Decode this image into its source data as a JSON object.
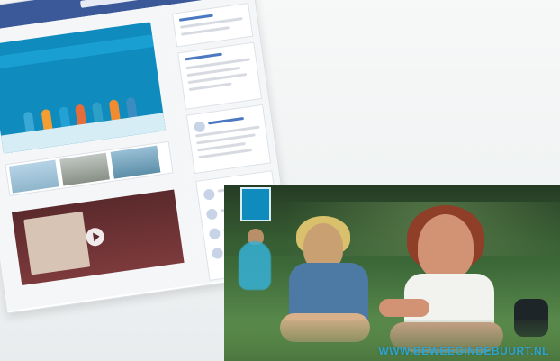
{
  "scene": {
    "background_color": "#f1f3f4"
  },
  "page": {
    "accent": "#3b5998",
    "banner_color": "#0f8bbd"
  },
  "photo": {
    "logo_text": "",
    "watermark": "WWW.BEWEEGINDEBUURT.NL"
  },
  "icons": [
    "play-icon"
  ]
}
